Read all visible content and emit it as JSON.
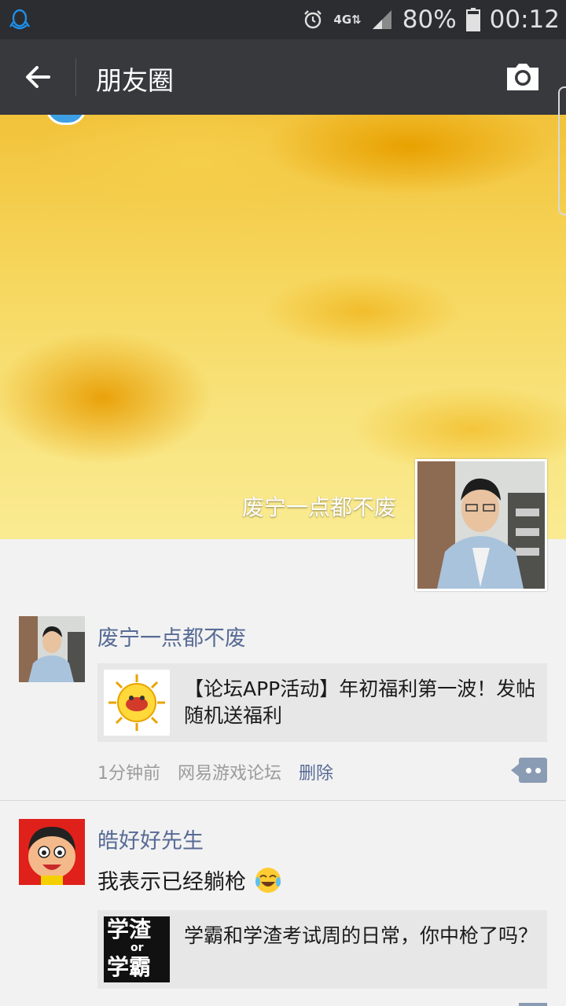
{
  "status_bar": {
    "battery": "80%",
    "time": "00:12",
    "network": "4G"
  },
  "header": {
    "title": "朋友圈"
  },
  "cover": {
    "user_name": "废宁一点都不废"
  },
  "posts": [
    {
      "user_name": "废宁一点都不废",
      "link_title": "【论坛APP活动】年初福利第一波！发帖随机送福利",
      "time_ago": "1分钟前",
      "source": "网易游戏论坛",
      "delete_label": "删除"
    },
    {
      "user_name": "皓好好先生",
      "text": "我表示已经躺枪",
      "link_title": "学霸和学渣考试周的日常，你中枪了吗？",
      "thumb_text_top": "学渣",
      "thumb_text_or": "or",
      "thumb_text_bottom": "学霸"
    }
  ],
  "colors": {
    "status_bar_bg": "#2b2d31",
    "header_bg": "#38393d",
    "link_name": "#576b95",
    "card_bg": "#e7e7e7"
  }
}
